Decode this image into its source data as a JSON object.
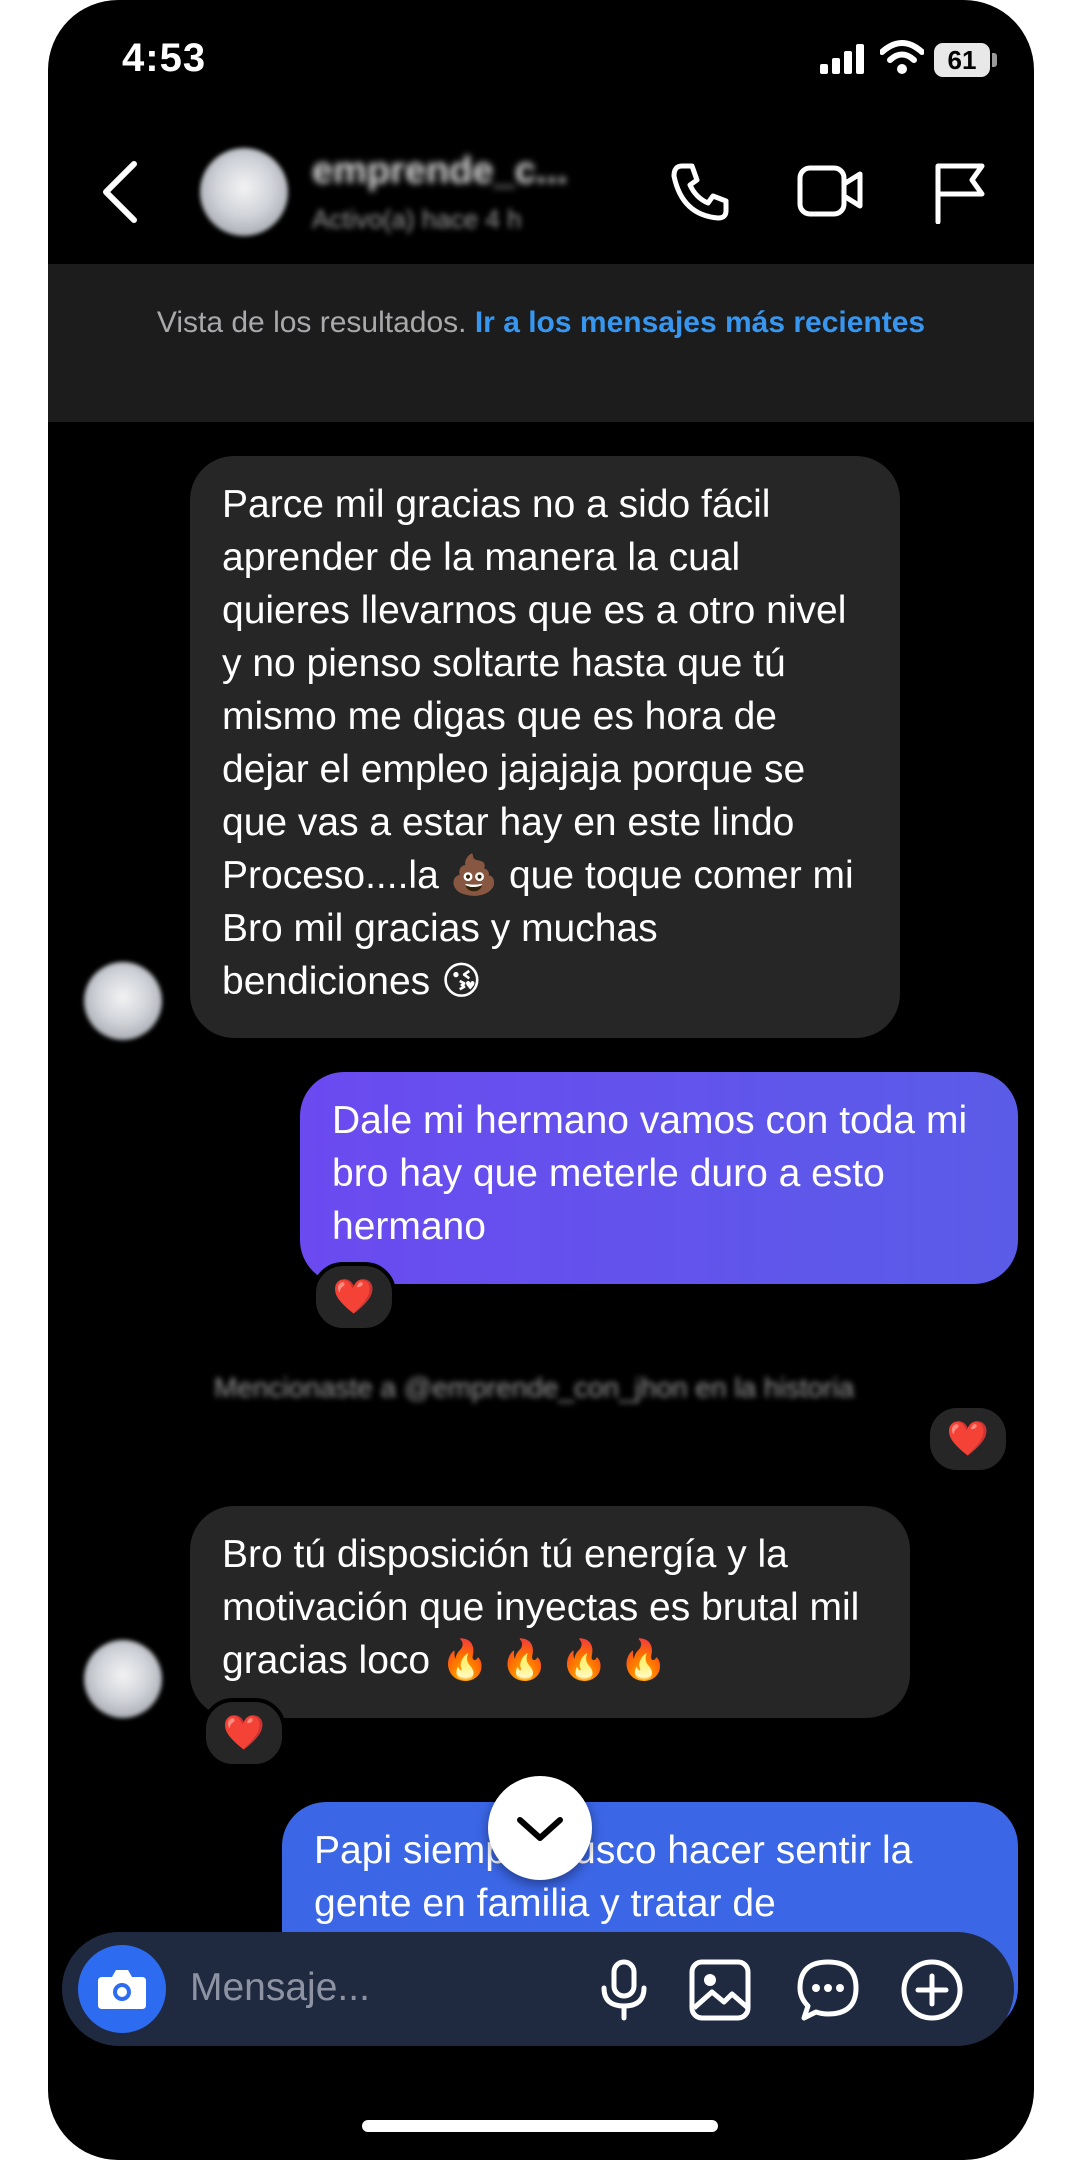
{
  "status_bar": {
    "time": "4:53",
    "battery": "61"
  },
  "header": {
    "name": "emprende_c...",
    "status": "Activo(a) hace 4 h",
    "icons": [
      "back-icon",
      "phone-call-icon",
      "video-call-icon",
      "flag-icon"
    ]
  },
  "banner": {
    "text": "Vista de los resultados.",
    "link": "Ir a los mensajes más recientes"
  },
  "messages": [
    {
      "direction": "incoming",
      "text": "Parce mil gracias no a sido fácil aprender de la manera la cual quieres llevarnos que es a otro nivel y no pienso soltarte hasta que tú mismo me digas que es hora de dejar el empleo jajajaja porque se que vas a estar hay en este lindo Proceso....la 💩 que toque comer mi Bro mil gracias y muchas bendiciones 😘"
    },
    {
      "direction": "outgoing",
      "text": "Dale mi hermano vamos con toda mi bro hay que meterle duro a esto hermano",
      "reaction": "❤️"
    },
    {
      "direction": "system",
      "text": "Mencionaste a @emprende_con_jhon en la historia",
      "reaction": "❤️"
    },
    {
      "direction": "incoming",
      "text": "Bro tú disposición tú energía y la motivación que inyectas es brutal mil gracias loco 🔥 🔥 🔥 🔥",
      "reaction": "❤️"
    },
    {
      "direction": "outgoing",
      "text": "Papi siempre busco hacer sentir la gente en familia y tratar de"
    }
  ],
  "composer": {
    "placeholder": "Mensaje..."
  },
  "colors": {
    "outgoing_purple": "#6b4af0",
    "outgoing_blue": "#3b66e6",
    "link": "#3797f0",
    "incoming": "#262626"
  }
}
